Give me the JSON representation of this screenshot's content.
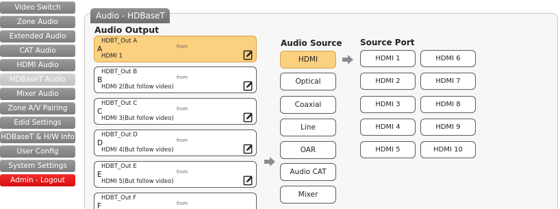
{
  "sidebar": {
    "items": [
      {
        "label": "Video Switch",
        "state": "normal"
      },
      {
        "label": "Zone Audio",
        "state": "normal"
      },
      {
        "label": "Extended Audio",
        "state": "normal"
      },
      {
        "label": "CAT Audio",
        "state": "normal"
      },
      {
        "label": "HDMI Audio",
        "state": "normal"
      },
      {
        "label": "HDBaseT Audio",
        "state": "active"
      },
      {
        "label": "Mixer Audio",
        "state": "normal"
      },
      {
        "label": "Zone A/V Pairing",
        "state": "normal"
      },
      {
        "label": "Edid Settings",
        "state": "normal"
      },
      {
        "label": "HDBaseT & H/W Info",
        "state": "normal"
      },
      {
        "label": "User Config",
        "state": "normal"
      },
      {
        "label": "System Settings",
        "state": "normal"
      },
      {
        "label": "Admin - Logout",
        "state": "logout"
      }
    ]
  },
  "panel": {
    "title": "Audio - HDBaseT",
    "audio_output_label": "Audio Output",
    "outputs": [
      {
        "name": "HDBT_Out A",
        "letter": "A",
        "from": "from",
        "source": "HDMI 1",
        "selected": true
      },
      {
        "name": "HDBT_Out B",
        "letter": "B",
        "from": "from",
        "source": "HDMI 2(But follow video)",
        "selected": false
      },
      {
        "name": "HDBT_Out C",
        "letter": "C",
        "from": "from",
        "source": "HDMI 3(But follow video)",
        "selected": false
      },
      {
        "name": "HDBT_Out D",
        "letter": "D",
        "from": "from",
        "source": "HDMI 4(But follow video)",
        "selected": false
      },
      {
        "name": "HDBT_Out E",
        "letter": "E",
        "from": "from",
        "source": "HDMI 5(But follow video)",
        "selected": false
      },
      {
        "name": "HDBT_Out F",
        "letter": "F",
        "from": "from",
        "source": "",
        "selected": false
      }
    ],
    "audio_source_label": "Audio Source",
    "sources": [
      {
        "label": "HDMI",
        "selected": true
      },
      {
        "label": "Optical",
        "selected": false
      },
      {
        "label": "Coaxial",
        "selected": false
      },
      {
        "label": "Line",
        "selected": false
      },
      {
        "label": "OAR",
        "selected": false
      },
      {
        "label": "Audio CAT",
        "selected": false
      },
      {
        "label": "Mixer",
        "selected": false
      }
    ],
    "source_port_label": "Source Port",
    "ports_left": [
      "HDMI 1",
      "HDMI 2",
      "HDMI 3",
      "HDMI 4",
      "HDMI 5"
    ],
    "ports_right": [
      "HDMI 6",
      "HDMI 7",
      "HDMI 8",
      "HDMI 9",
      "HDMI 10"
    ]
  },
  "colors": {
    "nav": "#8a8a8a",
    "nav_active": "#cccccc",
    "logout": "#e61a1a",
    "selected": "#fbd07e",
    "arrow": "#8c8c8c"
  },
  "icons": {
    "edit": "edit-pencil-icon",
    "arrow": "arrow-right-icon"
  }
}
